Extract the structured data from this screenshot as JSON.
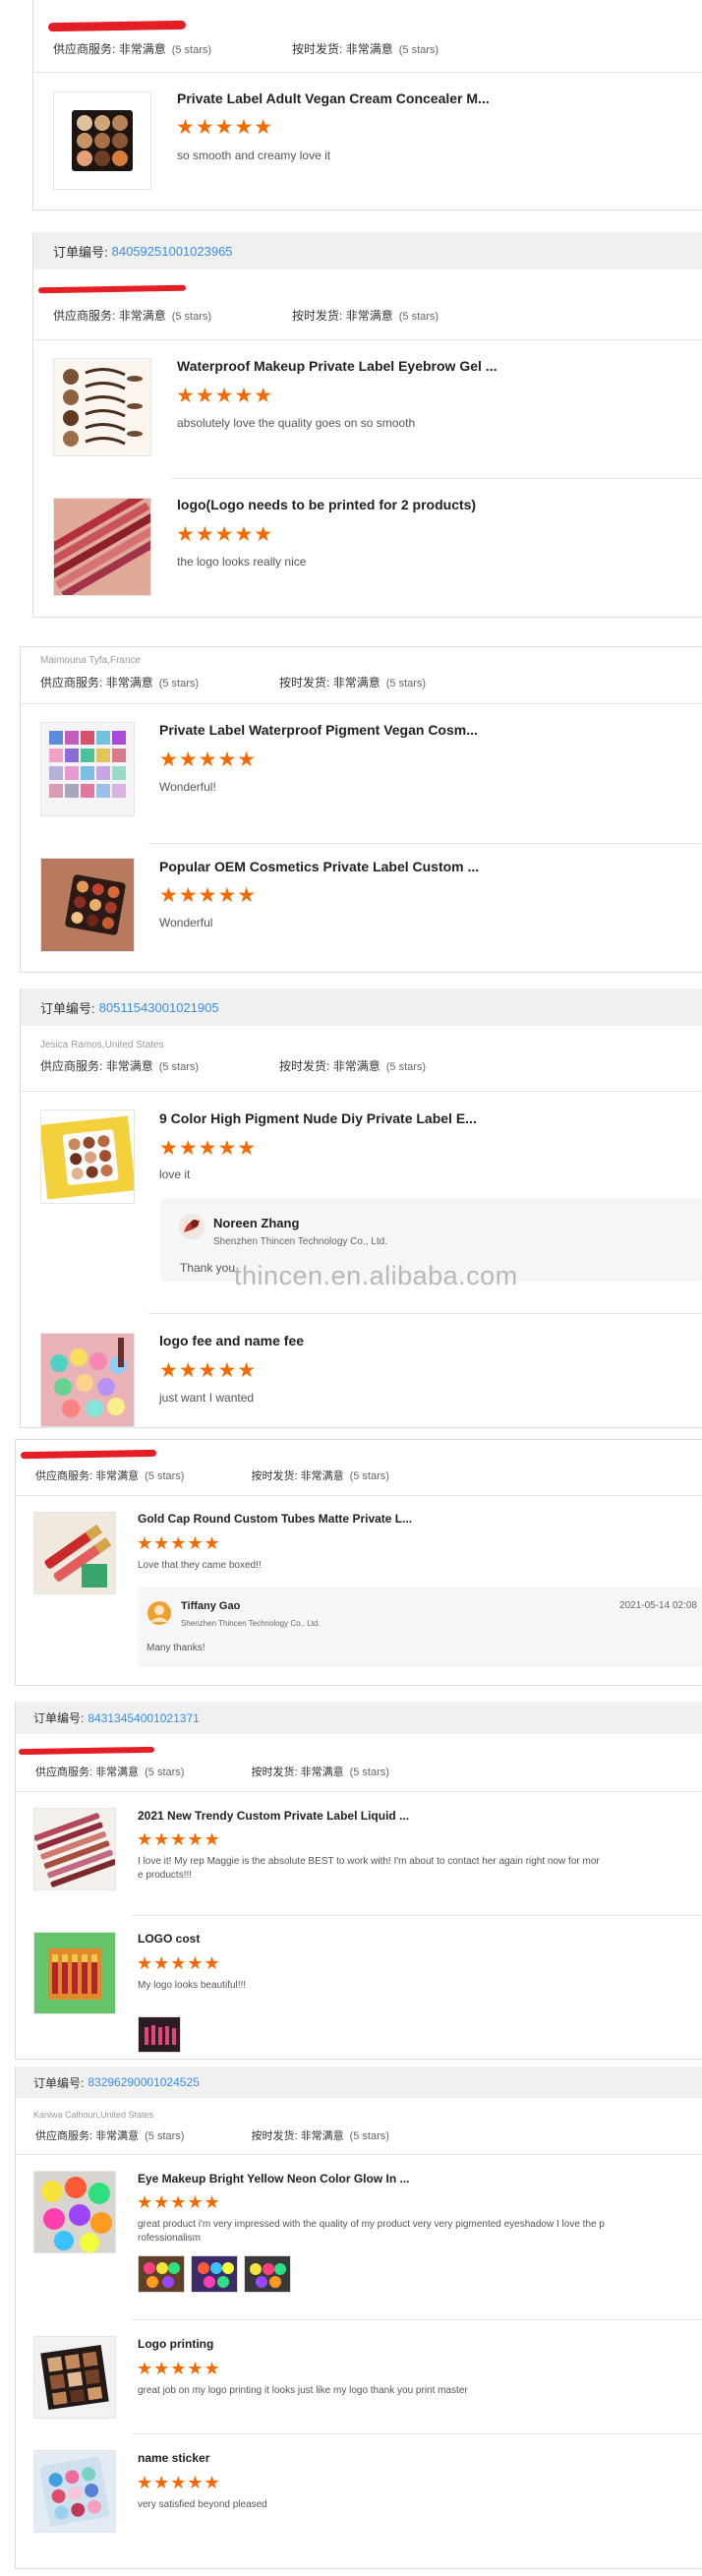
{
  "labels": {
    "order_no": "订单编号:",
    "supplier_service": "供应商服务:",
    "ontime_delivery": "按时发货:",
    "very_satisfied": "非常满意",
    "five_stars": "(5 stars)",
    "stars": "★★★★★"
  },
  "watermark": "thincen.en.alibaba.com",
  "block1": {
    "items": [
      {
        "title": "Private Label Adult Vegan Cream Concealer M...",
        "comment": "so smooth and creamy love it"
      }
    ]
  },
  "block2": {
    "order_number": "84059251001023965",
    "items": [
      {
        "title": "Waterproof Makeup Private Label Eyebrow Gel ...",
        "comment": "absolutely love the quality goes on so smooth"
      },
      {
        "title": "logo(Logo needs to be printed for 2 products)",
        "comment": "the logo looks really nice"
      }
    ]
  },
  "block3": {
    "buyer": "Maimouna Tyfa,France",
    "items": [
      {
        "title": "Private Label Waterproof Pigment Vegan Cosm...",
        "comment": "Wonderful!"
      },
      {
        "title": "Popular OEM Cosmetics Private Label Custom ...",
        "comment": "Wonderful"
      }
    ]
  },
  "block4": {
    "order_number": "80511543001021905",
    "buyer": "Jesica Ramos,United States",
    "items": [
      {
        "title": "9 Color High Pigment Nude Diy Private Label E...",
        "comment": "love it"
      },
      {
        "title": "logo fee and name fee",
        "comment": "just want I wanted"
      }
    ],
    "reply": {
      "name": "Noreen Zhang",
      "company": "Shenzhen Thincen Technology Co., Ltd.",
      "text": "Thank you"
    }
  },
  "block5": {
    "items": [
      {
        "title": "Gold Cap Round Custom Tubes Matte Private L...",
        "comment": "Love that they came boxed!!"
      }
    ],
    "reply": {
      "name": "Tiffany Gao",
      "company": "Shenzhen Thincen Technology Co., Ltd.",
      "text": "Many thanks!",
      "date": "2021-05-14 02:08"
    }
  },
  "block6": {
    "order_number": "84313454001021371",
    "items": [
      {
        "title": "2021 New Trendy Custom Private Label Liquid ...",
        "comment1": "I love it! My rep Maggie is the absolute BEST to work with! I'm about to contact her again right now for mor",
        "comment2": "e products!!!"
      },
      {
        "title": "LOGO cost",
        "comment": "My logo looks beautiful!!!"
      }
    ]
  },
  "block7": {
    "order_number": "83296290001024525",
    "buyer": "Kaniwa Calhoun,United States",
    "items": [
      {
        "title": "Eye Makeup Bright Yellow Neon Color Glow In ...",
        "comment1": "great product i'm very impressed with the quality of my product very very pigmented eyeshadow I love the p",
        "comment2": "rofessionalism"
      },
      {
        "title": "Logo printing",
        "comment": "great job on my logo printing it looks just like my logo thank you print master"
      },
      {
        "title": "name sticker",
        "comment": "very satisfied beyond pleased"
      }
    ]
  }
}
